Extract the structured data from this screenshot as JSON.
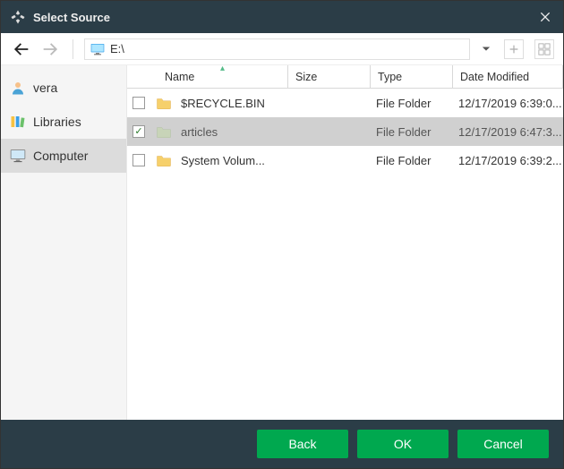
{
  "window": {
    "title": "Select Source"
  },
  "navbar": {
    "path": "E:\\"
  },
  "sidebar": {
    "items": [
      {
        "label": "vera",
        "icon": "user"
      },
      {
        "label": "Libraries",
        "icon": "libraries"
      },
      {
        "label": "Computer",
        "icon": "computer",
        "active": true
      }
    ]
  },
  "columns": {
    "name": "Name",
    "size": "Size",
    "type": "Type",
    "date": "Date Modified"
  },
  "rows": [
    {
      "name": "$RECYCLE.BIN",
      "size": "",
      "type": "File Folder",
      "date": "12/17/2019 6:39:0...",
      "checked": false,
      "selected": false
    },
    {
      "name": "articles",
      "size": "",
      "type": "File Folder",
      "date": "12/17/2019 6:47:3...",
      "checked": true,
      "selected": true
    },
    {
      "name": "System Volum...",
      "size": "",
      "type": "File Folder",
      "date": "12/17/2019 6:39:2...",
      "checked": false,
      "selected": false
    }
  ],
  "footer": {
    "back": "Back",
    "ok": "OK",
    "cancel": "Cancel"
  }
}
